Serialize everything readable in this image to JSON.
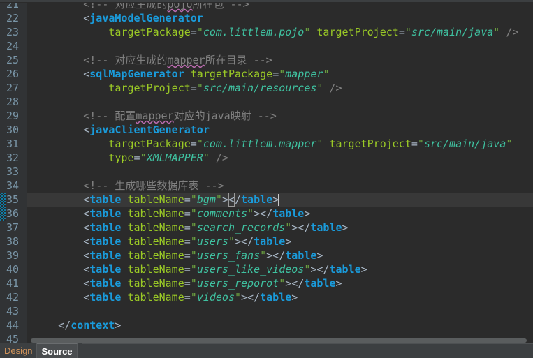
{
  "editor": {
    "theme_name": "darcula",
    "colors": {
      "background": "#2b2b2b",
      "gutter_background": "#313335",
      "current_line_background": "#383838",
      "line_number": "#7a96a8",
      "tag_name": "#1a9bdb",
      "attribute_name": "#9ac926",
      "attribute_value": "#3fc1a0",
      "comment": "#808080",
      "punctuation": "#a9b7c6",
      "change_marker": "#0d7ea8",
      "spellcheck_squiggle": "#bc6cb0",
      "caret": "#c8c8c8"
    },
    "first_visible_line": 21,
    "current_line": 35,
    "changed_lines": [
      35,
      36
    ],
    "caret_line": 35,
    "lines": [
      {
        "number": "21",
        "clipped_top": true,
        "tokens": [
          {
            "t": "        ",
            "c": "plain"
          },
          {
            "t": "<!-- 对应生成的",
            "c": "comment"
          },
          {
            "t": "pojo",
            "c": "comment-spell"
          },
          {
            "t": "所在包 -->",
            "c": "comment"
          }
        ]
      },
      {
        "number": "22",
        "tokens": [
          {
            "t": "        ",
            "c": "plain"
          },
          {
            "t": "<",
            "c": "bracket"
          },
          {
            "t": "javaModelGenerator",
            "c": "tag"
          }
        ]
      },
      {
        "number": "23",
        "tokens": [
          {
            "t": "            ",
            "c": "plain"
          },
          {
            "t": "targetPackage",
            "c": "attr"
          },
          {
            "t": "=",
            "c": "eq"
          },
          {
            "t": "\"",
            "c": "quote"
          },
          {
            "t": "com.littlem.pojo",
            "c": "value"
          },
          {
            "t": "\"",
            "c": "quote"
          },
          {
            "t": " ",
            "c": "plain"
          },
          {
            "t": "targetProject",
            "c": "attr"
          },
          {
            "t": "=",
            "c": "eq"
          },
          {
            "t": "\"",
            "c": "quote"
          },
          {
            "t": "src/main/java",
            "c": "value"
          },
          {
            "t": "\"",
            "c": "quote"
          },
          {
            "t": " ",
            "c": "plain"
          },
          {
            "t": "/>",
            "c": "selfclose"
          }
        ]
      },
      {
        "number": "24",
        "tokens": []
      },
      {
        "number": "25",
        "tokens": [
          {
            "t": "        ",
            "c": "plain"
          },
          {
            "t": "<!-- 对应生成的",
            "c": "comment"
          },
          {
            "t": "mapper",
            "c": "comment-spell"
          },
          {
            "t": "所在目录 -->",
            "c": "comment"
          }
        ]
      },
      {
        "number": "26",
        "tokens": [
          {
            "t": "        ",
            "c": "plain"
          },
          {
            "t": "<",
            "c": "bracket"
          },
          {
            "t": "sqlMapGenerator",
            "c": "tag"
          },
          {
            "t": " ",
            "c": "plain"
          },
          {
            "t": "targetPackage",
            "c": "attr"
          },
          {
            "t": "=",
            "c": "eq"
          },
          {
            "t": "\"",
            "c": "quote"
          },
          {
            "t": "mapper",
            "c": "value"
          },
          {
            "t": "\"",
            "c": "quote"
          }
        ]
      },
      {
        "number": "27",
        "tokens": [
          {
            "t": "            ",
            "c": "plain"
          },
          {
            "t": "targetProject",
            "c": "attr"
          },
          {
            "t": "=",
            "c": "eq"
          },
          {
            "t": "\"",
            "c": "quote"
          },
          {
            "t": "src/main/resources",
            "c": "value"
          },
          {
            "t": "\"",
            "c": "quote"
          },
          {
            "t": " ",
            "c": "plain"
          },
          {
            "t": "/>",
            "c": "selfclose"
          }
        ]
      },
      {
        "number": "28",
        "tokens": []
      },
      {
        "number": "29",
        "tokens": [
          {
            "t": "        ",
            "c": "plain"
          },
          {
            "t": "<!-- 配置",
            "c": "comment"
          },
          {
            "t": "mapper",
            "c": "comment-spell"
          },
          {
            "t": "对应的java映射 -->",
            "c": "comment"
          }
        ]
      },
      {
        "number": "30",
        "tokens": [
          {
            "t": "        ",
            "c": "plain"
          },
          {
            "t": "<",
            "c": "bracket"
          },
          {
            "t": "javaClientGenerator",
            "c": "tag"
          }
        ]
      },
      {
        "number": "31",
        "tokens": [
          {
            "t": "            ",
            "c": "plain"
          },
          {
            "t": "targetPackage",
            "c": "attr"
          },
          {
            "t": "=",
            "c": "eq"
          },
          {
            "t": "\"",
            "c": "quote"
          },
          {
            "t": "com.littlem.mapper",
            "c": "value"
          },
          {
            "t": "\"",
            "c": "quote"
          },
          {
            "t": " ",
            "c": "plain"
          },
          {
            "t": "targetProject",
            "c": "attr"
          },
          {
            "t": "=",
            "c": "eq"
          },
          {
            "t": "\"",
            "c": "quote"
          },
          {
            "t": "src/main/java",
            "c": "value"
          },
          {
            "t": "\"",
            "c": "quote"
          }
        ]
      },
      {
        "number": "32",
        "tokens": [
          {
            "t": "            ",
            "c": "plain"
          },
          {
            "t": "type",
            "c": "attr"
          },
          {
            "t": "=",
            "c": "eq"
          },
          {
            "t": "\"",
            "c": "quote"
          },
          {
            "t": "XMLMAPPER",
            "c": "value"
          },
          {
            "t": "\"",
            "c": "quote"
          },
          {
            "t": " ",
            "c": "plain"
          },
          {
            "t": "/>",
            "c": "selfclose"
          }
        ]
      },
      {
        "number": "33",
        "tokens": []
      },
      {
        "number": "34",
        "tokens": [
          {
            "t": "        ",
            "c": "plain"
          },
          {
            "t": "<!-- 生成哪些数据库表 -->",
            "c": "comment"
          }
        ]
      },
      {
        "number": "35",
        "current": true,
        "tokens": [
          {
            "t": "        ",
            "c": "plain"
          },
          {
            "t": "<",
            "c": "bracket"
          },
          {
            "t": "table",
            "c": "tag"
          },
          {
            "t": " ",
            "c": "plain"
          },
          {
            "t": "tableName",
            "c": "attr"
          },
          {
            "t": "=",
            "c": "eq"
          },
          {
            "t": "\"",
            "c": "quote"
          },
          {
            "t": "bgm",
            "c": "value"
          },
          {
            "t": "\"",
            "c": "quote"
          },
          {
            "t": ">",
            "c": "bracket"
          },
          {
            "t": "<",
            "c": "bracket-matched"
          },
          {
            "t": "/",
            "c": "bracket"
          },
          {
            "t": "table",
            "c": "tag"
          },
          {
            "t": ">",
            "c": "bracket"
          },
          {
            "t": "",
            "c": "caret"
          }
        ]
      },
      {
        "number": "36",
        "tokens": [
          {
            "t": "        ",
            "c": "plain"
          },
          {
            "t": "<",
            "c": "bracket"
          },
          {
            "t": "table",
            "c": "tag"
          },
          {
            "t": " ",
            "c": "plain"
          },
          {
            "t": "tableName",
            "c": "attr"
          },
          {
            "t": "=",
            "c": "eq"
          },
          {
            "t": "\"",
            "c": "quote"
          },
          {
            "t": "comments",
            "c": "value"
          },
          {
            "t": "\"",
            "c": "quote"
          },
          {
            "t": "></",
            "c": "bracket"
          },
          {
            "t": "table",
            "c": "tag"
          },
          {
            "t": ">",
            "c": "bracket"
          }
        ]
      },
      {
        "number": "37",
        "tokens": [
          {
            "t": "        ",
            "c": "plain"
          },
          {
            "t": "<",
            "c": "bracket"
          },
          {
            "t": "table",
            "c": "tag"
          },
          {
            "t": " ",
            "c": "plain"
          },
          {
            "t": "tableName",
            "c": "attr"
          },
          {
            "t": "=",
            "c": "eq"
          },
          {
            "t": "\"",
            "c": "quote"
          },
          {
            "t": "search_records",
            "c": "value"
          },
          {
            "t": "\"",
            "c": "quote"
          },
          {
            "t": "></",
            "c": "bracket"
          },
          {
            "t": "table",
            "c": "tag"
          },
          {
            "t": ">",
            "c": "bracket"
          }
        ]
      },
      {
        "number": "38",
        "tokens": [
          {
            "t": "        ",
            "c": "plain"
          },
          {
            "t": "<",
            "c": "bracket"
          },
          {
            "t": "table",
            "c": "tag"
          },
          {
            "t": " ",
            "c": "plain"
          },
          {
            "t": "tableName",
            "c": "attr"
          },
          {
            "t": "=",
            "c": "eq"
          },
          {
            "t": "\"",
            "c": "quote"
          },
          {
            "t": "users",
            "c": "value"
          },
          {
            "t": "\"",
            "c": "quote"
          },
          {
            "t": "></",
            "c": "bracket"
          },
          {
            "t": "table",
            "c": "tag"
          },
          {
            "t": ">",
            "c": "bracket"
          }
        ]
      },
      {
        "number": "39",
        "tokens": [
          {
            "t": "        ",
            "c": "plain"
          },
          {
            "t": "<",
            "c": "bracket"
          },
          {
            "t": "table",
            "c": "tag"
          },
          {
            "t": " ",
            "c": "plain"
          },
          {
            "t": "tableName",
            "c": "attr"
          },
          {
            "t": "=",
            "c": "eq"
          },
          {
            "t": "\"",
            "c": "quote"
          },
          {
            "t": "users_fans",
            "c": "value"
          },
          {
            "t": "\"",
            "c": "quote"
          },
          {
            "t": "></",
            "c": "bracket"
          },
          {
            "t": "table",
            "c": "tag"
          },
          {
            "t": ">",
            "c": "bracket"
          }
        ]
      },
      {
        "number": "40",
        "tokens": [
          {
            "t": "        ",
            "c": "plain"
          },
          {
            "t": "<",
            "c": "bracket"
          },
          {
            "t": "table",
            "c": "tag"
          },
          {
            "t": " ",
            "c": "plain"
          },
          {
            "t": "tableName",
            "c": "attr"
          },
          {
            "t": "=",
            "c": "eq"
          },
          {
            "t": "\"",
            "c": "quote"
          },
          {
            "t": "users_like_videos",
            "c": "value"
          },
          {
            "t": "\"",
            "c": "quote"
          },
          {
            "t": "></",
            "c": "bracket"
          },
          {
            "t": "table",
            "c": "tag"
          },
          {
            "t": ">",
            "c": "bracket"
          }
        ]
      },
      {
        "number": "41",
        "tokens": [
          {
            "t": "        ",
            "c": "plain"
          },
          {
            "t": "<",
            "c": "bracket"
          },
          {
            "t": "table",
            "c": "tag"
          },
          {
            "t": " ",
            "c": "plain"
          },
          {
            "t": "tableName",
            "c": "attr"
          },
          {
            "t": "=",
            "c": "eq"
          },
          {
            "t": "\"",
            "c": "quote"
          },
          {
            "t": "users_reporot",
            "c": "value"
          },
          {
            "t": "\"",
            "c": "quote"
          },
          {
            "t": "></",
            "c": "bracket"
          },
          {
            "t": "table",
            "c": "tag"
          },
          {
            "t": ">",
            "c": "bracket"
          }
        ]
      },
      {
        "number": "42",
        "tokens": [
          {
            "t": "        ",
            "c": "plain"
          },
          {
            "t": "<",
            "c": "bracket"
          },
          {
            "t": "table",
            "c": "tag"
          },
          {
            "t": " ",
            "c": "plain"
          },
          {
            "t": "tableName",
            "c": "attr"
          },
          {
            "t": "=",
            "c": "eq"
          },
          {
            "t": "\"",
            "c": "quote"
          },
          {
            "t": "videos",
            "c": "value"
          },
          {
            "t": "\"",
            "c": "quote"
          },
          {
            "t": "></",
            "c": "bracket"
          },
          {
            "t": "table",
            "c": "tag"
          },
          {
            "t": ">",
            "c": "bracket"
          }
        ]
      },
      {
        "number": "43",
        "tokens": []
      },
      {
        "number": "44",
        "tokens": [
          {
            "t": "    ",
            "c": "plain"
          },
          {
            "t": "</",
            "c": "bracket"
          },
          {
            "t": "context",
            "c": "tag"
          },
          {
            "t": ">",
            "c": "bracket"
          }
        ]
      },
      {
        "number": "45",
        "clipped_bottom": true,
        "tokens": [
          {
            "t": "",
            "c": "plain"
          }
        ]
      }
    ]
  },
  "scrollbar": {
    "orientation": "horizontal",
    "visible": true
  },
  "tabs": [
    {
      "label": "Design",
      "active": false
    },
    {
      "label": "Source",
      "active": true
    }
  ]
}
